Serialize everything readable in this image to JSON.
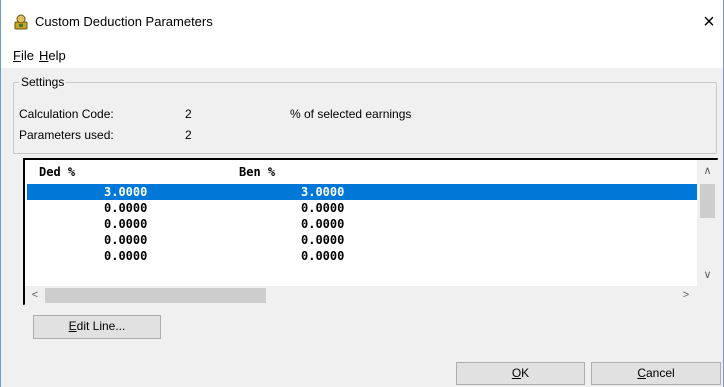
{
  "window": {
    "title": "Custom Deduction Parameters",
    "close_glyph": "×"
  },
  "menu": {
    "file": {
      "accel": "F",
      "rest": "ile"
    },
    "help": {
      "accel": "H",
      "rest": "elp"
    }
  },
  "settings": {
    "group_label": "Settings",
    "calc_code_label": "Calculation Code:",
    "calc_code_value": "2",
    "calc_code_desc": "% of selected earnings",
    "params_used_label": "Parameters used:",
    "params_used_value": "2"
  },
  "table": {
    "columns": [
      "Ded %",
      "Ben %"
    ],
    "rows": [
      {
        "ded": "3.0000",
        "ben": "3.0000",
        "selected": true
      },
      {
        "ded": "0.0000",
        "ben": "0.0000"
      },
      {
        "ded": "0.0000",
        "ben": "0.0000"
      },
      {
        "ded": "0.0000",
        "ben": "0.0000"
      },
      {
        "ded": "0.0000",
        "ben": "0.0000"
      }
    ],
    "scroll_up": "∧",
    "scroll_down": "∨",
    "scroll_left": "<",
    "scroll_right": ">"
  },
  "buttons": {
    "edit_line": {
      "accel": "E",
      "rest": "dit Line..."
    },
    "ok": {
      "accel": "O",
      "rest": "K"
    },
    "cancel": {
      "accel": "C",
      "rest": "ancel"
    }
  },
  "colors": {
    "selection": "#0078d7",
    "window_border": "#6c9ad1"
  }
}
